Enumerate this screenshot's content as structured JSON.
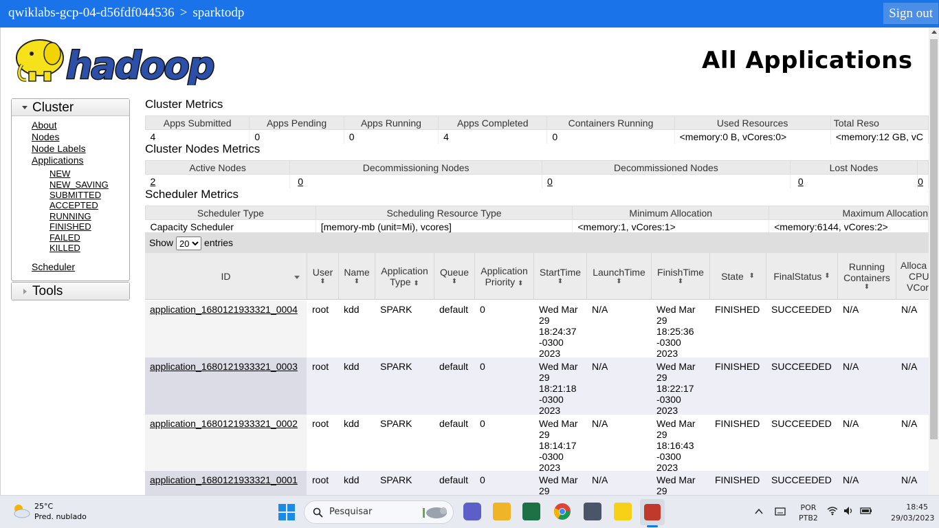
{
  "topbar": {
    "project": "qwiklabs-gcp-04-d56fdf044536",
    "separator": ">",
    "cluster": "sparktodp",
    "signout": "Sign out"
  },
  "page_title": "All Applications",
  "sidebar": {
    "cluster_label": "Cluster",
    "links": [
      "About",
      "Nodes",
      "Node Labels",
      "Applications"
    ],
    "app_states": [
      "NEW",
      "NEW_SAVING",
      "SUBMITTED",
      "ACCEPTED",
      "RUNNING",
      "FINISHED",
      "FAILED",
      "KILLED"
    ],
    "scheduler": "Scheduler",
    "tools_label": "Tools"
  },
  "cluster_metrics": {
    "title": "Cluster Metrics",
    "headers": [
      "Apps Submitted",
      "Apps Pending",
      "Apps Running",
      "Apps Completed",
      "Containers Running",
      "Used Resources",
      "Total Reso"
    ],
    "values": [
      "4",
      "0",
      "0",
      "4",
      "0",
      "<memory:0 B, vCores:0>",
      "<memory:12 GB, vC"
    ]
  },
  "nodes_metrics": {
    "title": "Cluster Nodes Metrics",
    "headers": [
      "Active Nodes",
      "Decommissioning Nodes",
      "Decommissioned Nodes",
      "Lost Nodes",
      ""
    ],
    "values": [
      "2",
      "0",
      "0",
      "0",
      "0"
    ]
  },
  "scheduler_metrics": {
    "title": "Scheduler Metrics",
    "headers": [
      "Scheduler Type",
      "Scheduling Resource Type",
      "Minimum Allocation",
      "Maximum Allocation"
    ],
    "values": [
      "Capacity Scheduler",
      "[memory-mb (unit=Mi), vcores]",
      "<memory:1, vCores:1>",
      "<memory:6144, vCores:2>"
    ]
  },
  "entries": {
    "show": "Show",
    "value": "20",
    "label": "entries"
  },
  "apps_table": {
    "headers": {
      "id": "ID",
      "user": "User",
      "name": "Name",
      "app_type": [
        "Application",
        "Type"
      ],
      "queue": "Queue",
      "priority": [
        "Application",
        "Priority"
      ],
      "start": "StartTime",
      "launch": "LaunchTime",
      "finish": "FinishTime",
      "state": "State",
      "final": "FinalStatus",
      "running": [
        "Running",
        "Containers"
      ],
      "alloc": [
        "Alloca",
        "CPU",
        "VCor"
      ]
    },
    "rows": [
      {
        "id": "application_1680121933321_0004",
        "user": "root",
        "name": "kdd",
        "type": "SPARK",
        "queue": "default",
        "priority": "0",
        "start": [
          "Wed Mar",
          "29",
          "18:24:37",
          "-0300",
          "2023"
        ],
        "launch": "N/A",
        "finish": [
          "Wed Mar",
          "29",
          "18:25:36",
          "-0300",
          "2023"
        ],
        "state": "FINISHED",
        "final": "SUCCEEDED",
        "running": "N/A",
        "alloc": "N/A"
      },
      {
        "id": "application_1680121933321_0003",
        "user": "root",
        "name": "kdd",
        "type": "SPARK",
        "queue": "default",
        "priority": "0",
        "start": [
          "Wed Mar",
          "29",
          "18:21:18",
          "-0300",
          "2023"
        ],
        "launch": "N/A",
        "finish": [
          "Wed Mar",
          "29",
          "18:22:17",
          "-0300",
          "2023"
        ],
        "state": "FINISHED",
        "final": "SUCCEEDED",
        "running": "N/A",
        "alloc": "N/A"
      },
      {
        "id": "application_1680121933321_0002",
        "user": "root",
        "name": "kdd",
        "type": "SPARK",
        "queue": "default",
        "priority": "0",
        "start": [
          "Wed Mar",
          "29",
          "18:14:17",
          "-0300",
          "2023"
        ],
        "launch": "N/A",
        "finish": [
          "Wed Mar",
          "29",
          "18:16:43",
          "-0300",
          "2023"
        ],
        "state": "FINISHED",
        "final": "SUCCEEDED",
        "running": "N/A",
        "alloc": "N/A"
      },
      {
        "id": "application_1680121933321_0001",
        "user": "root",
        "name": "kdd",
        "type": "SPARK",
        "queue": "default",
        "priority": "0",
        "start": [
          "Wed Mar",
          "29"
        ],
        "launch": "N/A",
        "finish": [
          "Wed Mar",
          "29"
        ],
        "state": "FINISHED",
        "final": "SUCCEEDED",
        "running": "N/A",
        "alloc": "N/A"
      }
    ]
  },
  "taskbar": {
    "weather_temp": "25°C",
    "weather_desc": "Pred. nublado",
    "search_placeholder": "Pesquisar",
    "lang": "POR",
    "layout": "PTB2",
    "time": "18:45",
    "date": "29/03/2023"
  }
}
